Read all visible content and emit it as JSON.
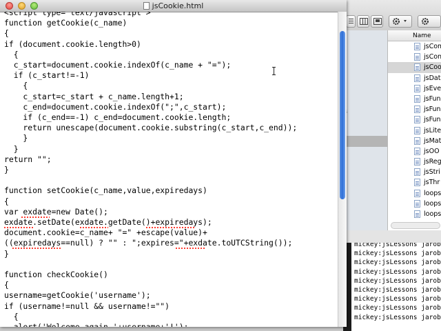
{
  "editor": {
    "title": "jsCookie.html",
    "lines": [
      "<script type=\"text/javascript\">",
      "function getCookie(c_name)",
      "{",
      "if (document.cookie.length>0)",
      "  {",
      "  c_start=document.cookie.indexOf(c_name + \"=\");",
      "  if (c_start!=-1)",
      "    {",
      "    c_start=c_start + c_name.length+1;",
      "    c_end=document.cookie.indexOf(\";\",c_start);",
      "    if (c_end==-1) c_end=document.cookie.length;",
      "    return unescape(document.cookie.substring(c_start,c_end));",
      "    }",
      "  }",
      "return \"\";",
      "}",
      "",
      "function setCookie(c_name,value,expiredays)",
      "{",
      "var exdate=new Date();",
      "exdate.setDate(exdate.getDate()+expiredays);",
      "document.cookie=c_name+ \"=\" +escape(value)+",
      "((expiredays==null) ? \"\" : \";expires=\"+exdate.toUTCString());",
      "}",
      "",
      "function checkCookie()",
      "{",
      "username=getCookie('username');",
      "if (username!=null && username!=\"\")",
      "  {",
      "  alert('Welcome again '+username+'!');"
    ]
  },
  "finder": {
    "column_header": "Name",
    "sidebar_hint": "s",
    "files": [
      {
        "name": "jsCom",
        "selected": false
      },
      {
        "name": "jsCon",
        "selected": false
      },
      {
        "name": "jsCoo",
        "selected": true
      },
      {
        "name": "jsDat",
        "selected": false
      },
      {
        "name": "jsEve",
        "selected": false
      },
      {
        "name": "jsFun",
        "selected": false
      },
      {
        "name": "jsFun",
        "selected": false
      },
      {
        "name": "jsFun",
        "selected": false
      },
      {
        "name": "jsLite",
        "selected": false
      },
      {
        "name": "jsMat",
        "selected": false
      },
      {
        "name": "jsOO",
        "selected": false
      },
      {
        "name": "jsReg",
        "selected": false
      },
      {
        "name": "jsStri",
        "selected": false
      },
      {
        "name": "jsThr",
        "selected": false
      },
      {
        "name": "loops",
        "selected": false
      },
      {
        "name": "loops",
        "selected": false
      },
      {
        "name": "loops",
        "selected": false
      }
    ]
  },
  "terminal": {
    "lines": [
      "mickey:jsLessons jarob",
      "mickey:jsLessons jarob",
      "mickey:jsLessons jarob",
      "mickey:jsLessons jarob",
      "mickey:jsLessons jarob",
      "mickey:jsLessons jarob",
      "mickey:jsLessons jarob",
      "mickey:jsLessons jarob",
      "mickey:jsLessons jarob"
    ]
  },
  "colors": {
    "scroll_thumb": "#2f6fd8",
    "spell_underline": "#ff3b30"
  }
}
